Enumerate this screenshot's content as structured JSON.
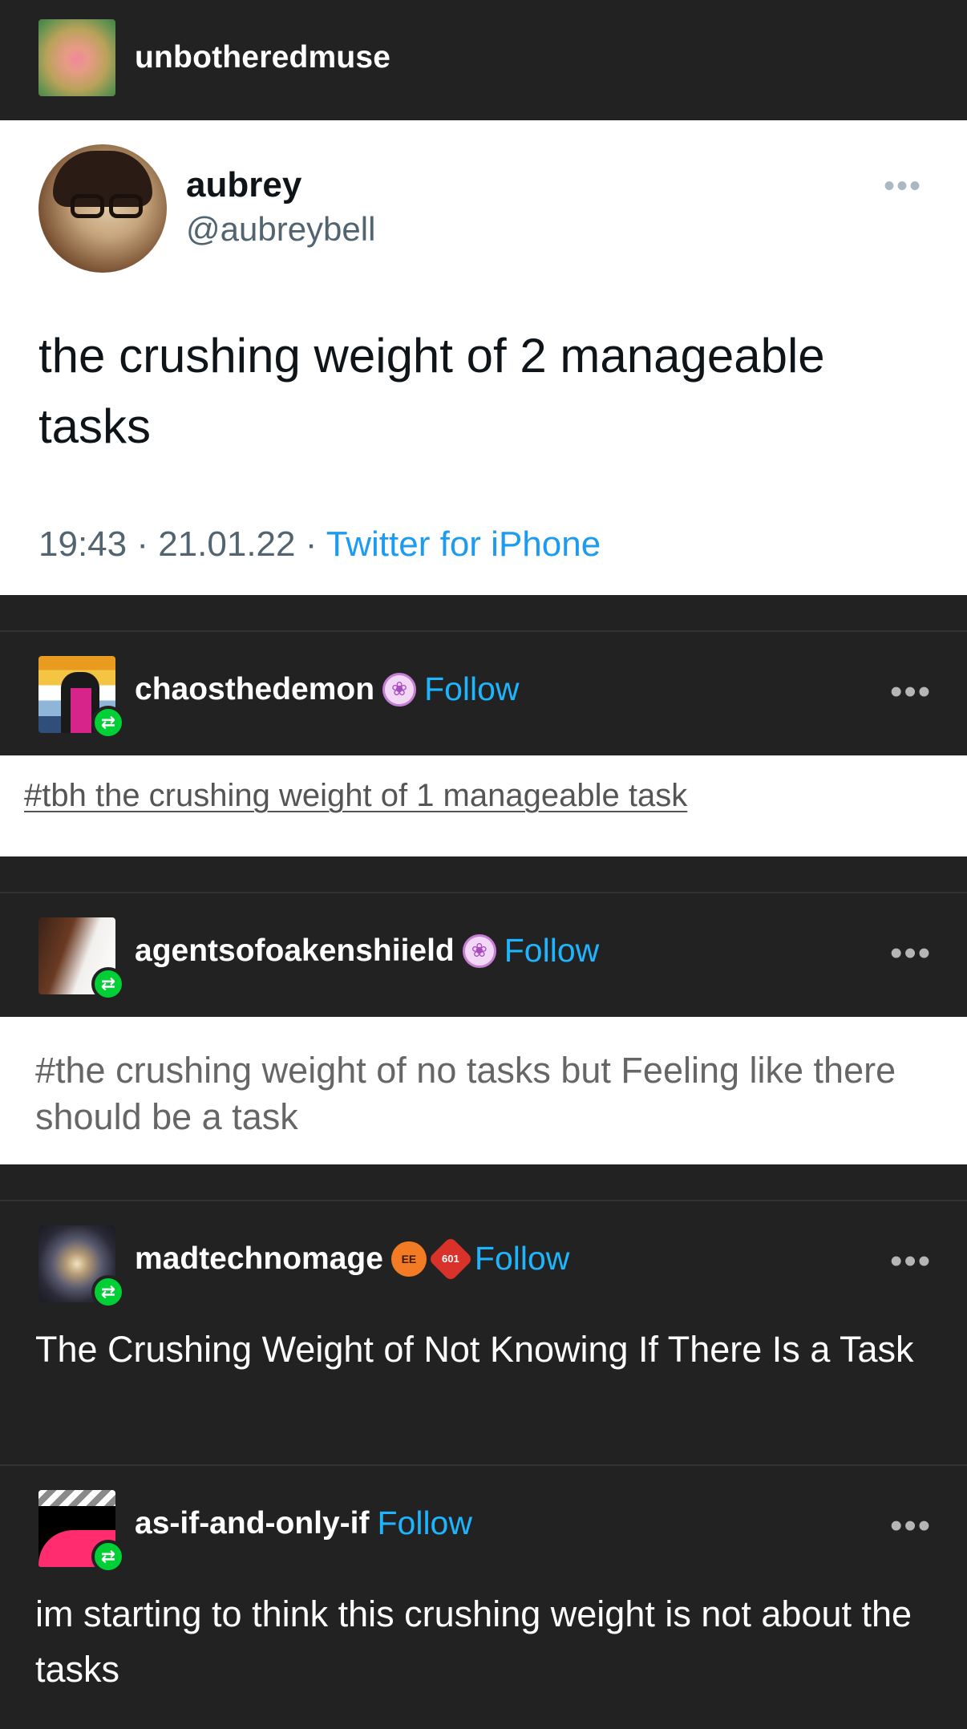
{
  "op": {
    "username": "unbotheredmuse"
  },
  "tweet": {
    "name": "aubrey",
    "handle": "@aubreybell",
    "more": "•••",
    "text": "the crushing weight of 2 manageable tasks",
    "time_date": "19:43 · 21.01.22 · ",
    "source": "Twitter for iPhone"
  },
  "reblogs": [
    {
      "username": "chaosthedemon",
      "follow": "Follow",
      "more": "•••",
      "tags": "#tbh the crushing weight of 1 manageable task"
    },
    {
      "username": "agentsofoakenshiield",
      "follow": "Follow",
      "more": "•••",
      "tags": "#the crushing weight of no tasks but Feeling like there should be a task"
    },
    {
      "username": "madtechnomage",
      "follow": "Follow",
      "more": "•••",
      "badge_orange": "EE",
      "badge_red": "601",
      "body": "The Crushing Weight of Not Knowing If There Is a Task"
    },
    {
      "username": "as-if-and-only-if",
      "follow": "Follow",
      "more": "•••",
      "body": "im starting to think this crushing weight is not about the tasks"
    }
  ],
  "icons": {
    "reblog": "⇄",
    "paw": "❀"
  },
  "colors": {
    "background": "#222223",
    "follow_blue": "#1eb5ff",
    "reblog_green": "#00cf35",
    "twitter_blue": "#1d9bf0"
  }
}
